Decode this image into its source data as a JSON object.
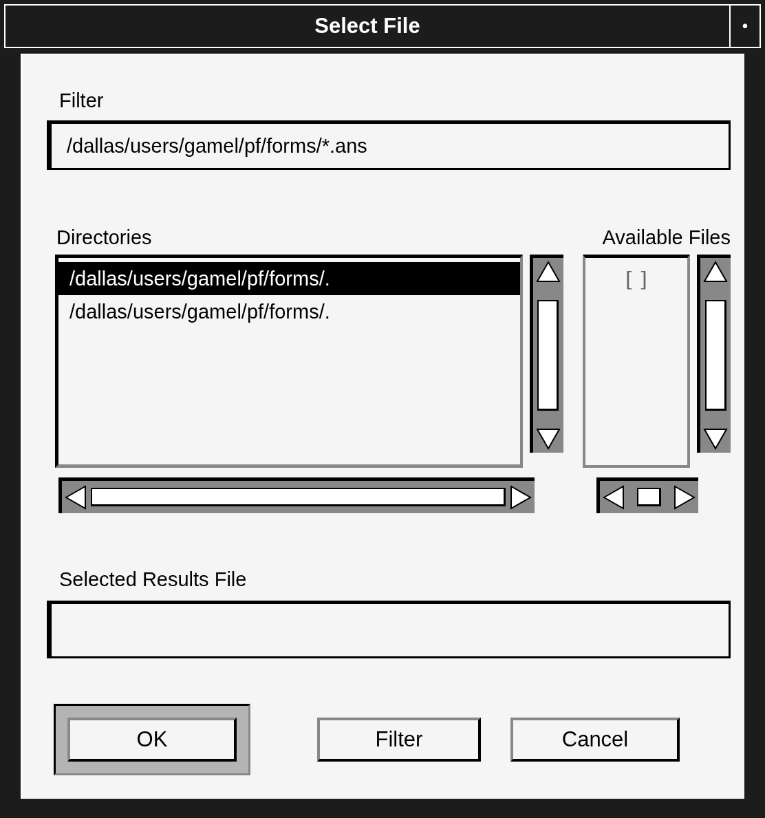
{
  "window": {
    "title": "Select File",
    "menu_button": "•"
  },
  "filter": {
    "label": "Filter",
    "value": "/dallas/users/gamel/pf/forms/*.ans"
  },
  "directories": {
    "label": "Directories",
    "items": [
      {
        "text": "/dallas/users/gamel/pf/forms/.",
        "selected": true
      },
      {
        "text": "/dallas/users/gamel/pf/forms/.",
        "selected": false
      }
    ]
  },
  "available_files": {
    "label": "Available Files",
    "items": [
      {
        "text": "[ ]",
        "disabled": true
      }
    ]
  },
  "selected_results_file": {
    "label": "Selected Results File"
  },
  "buttons": [
    {
      "label": "OK",
      "default": true
    },
    {
      "label": "Filter",
      "default": false
    },
    {
      "label": "Cancel",
      "default": false
    }
  ]
}
